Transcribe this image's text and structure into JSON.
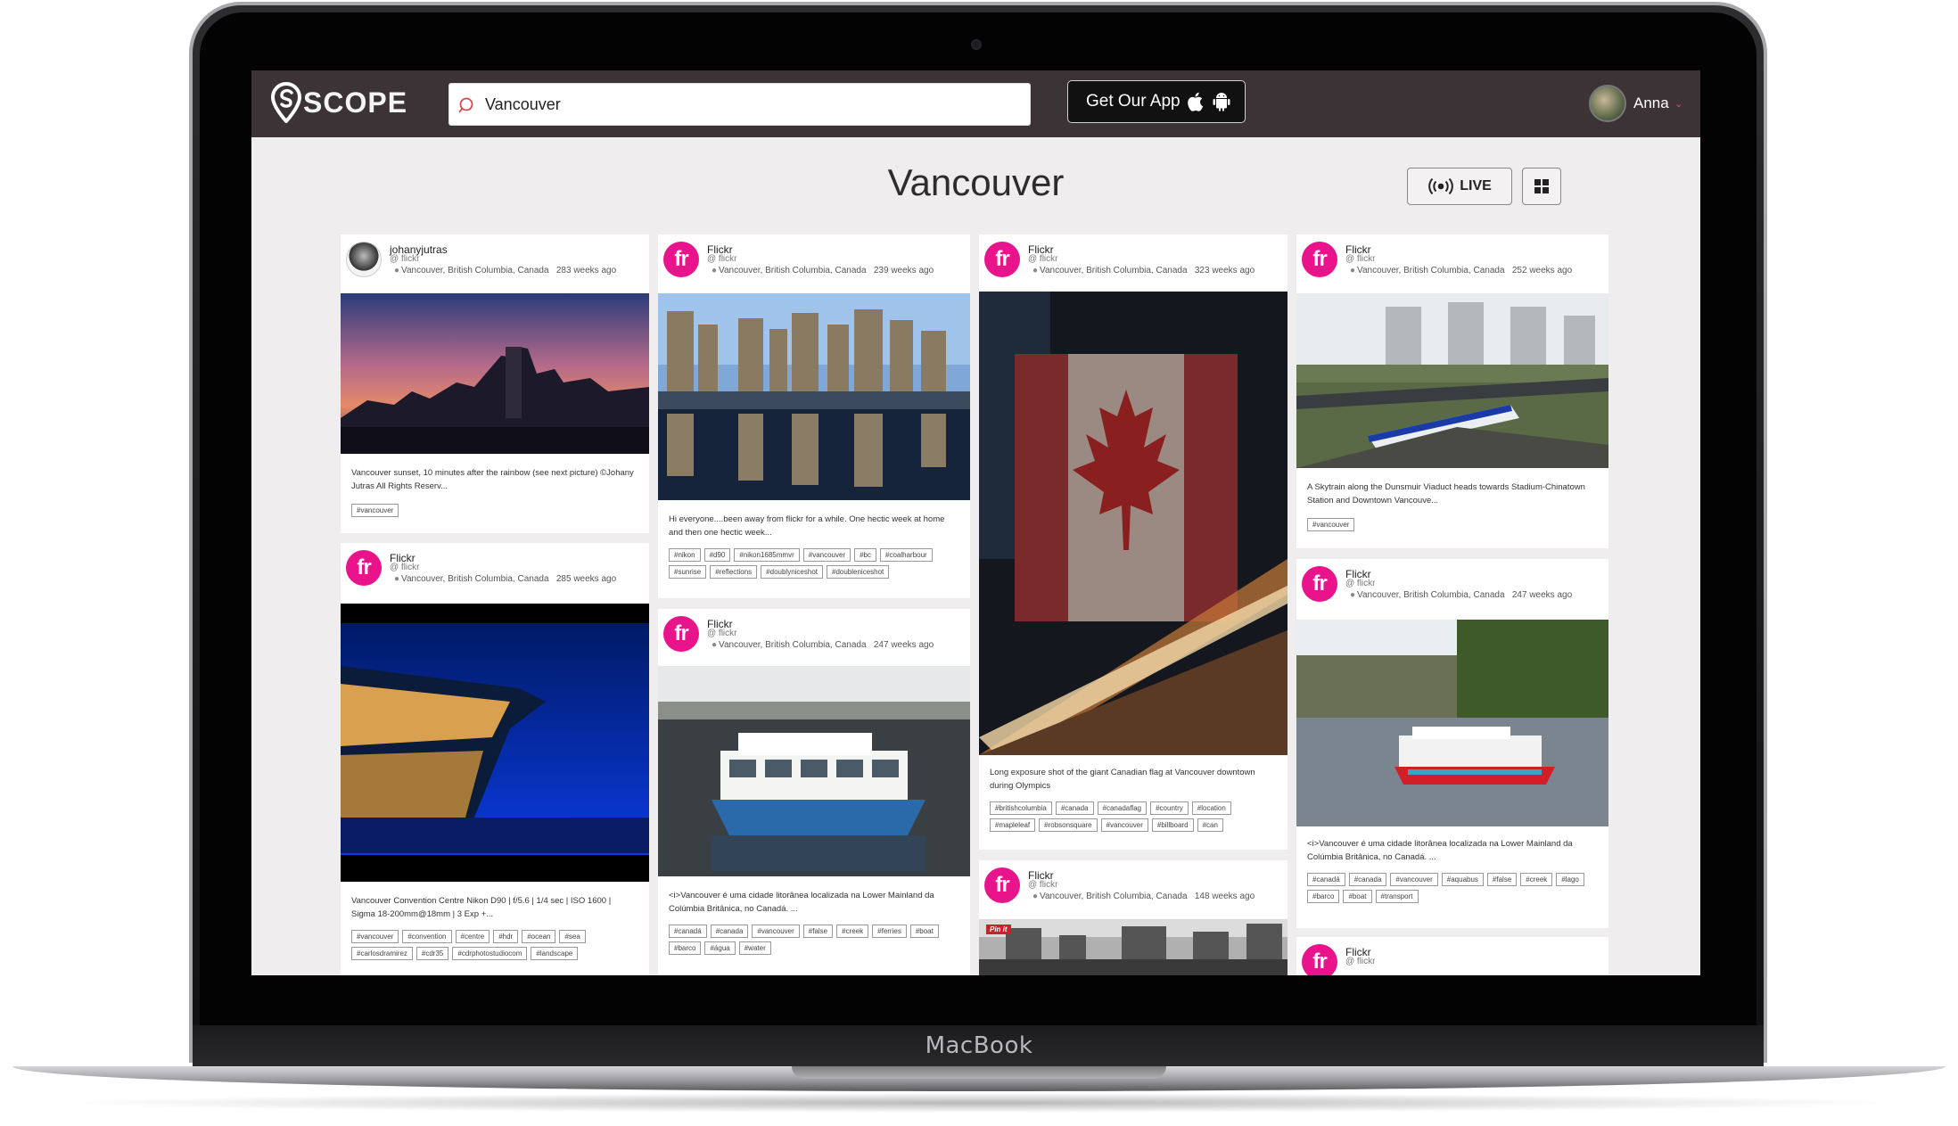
{
  "app": {
    "logo_text": "SCOPE",
    "brand_color": "#3c3336",
    "accent": "#e9138b"
  },
  "search": {
    "value": "Vancouver",
    "placeholder": ""
  },
  "get_app": {
    "label": "Get Our App"
  },
  "user": {
    "name": "Anna"
  },
  "page": {
    "title": "Vancouver",
    "live_label": "LIVE"
  },
  "device": {
    "label": "MacBook"
  },
  "cards": [
    {
      "user": "johanyjutras",
      "handle": "@ flickr",
      "location": "Vancouver, British Columbia, Canada",
      "time": "283 weeks ago",
      "caption": "Vancouver sunset, 10 minutes after the rainbow (see next picture) ©Johany Jutras All Rights Reserv...",
      "tags": [
        "#vancouver"
      ]
    },
    {
      "user": "Flickr",
      "handle": "@ flickr",
      "location": "Vancouver, British Columbia, Canada",
      "time": "285 weeks ago",
      "caption": "Vancouver Convention Centre Nikon D90 | f/5.6 | 1/4 sec | ISO 1600 | Sigma 18-200mm@18mm | 3 Exp +...",
      "tags": [
        "#vancouver",
        "#convention",
        "#centre",
        "#hdr",
        "#ocean",
        "#sea",
        "#carlosdramirez",
        "#cdr35",
        "#cdrphotostudiocom",
        "#landscape"
      ]
    },
    {
      "user": "Flickr",
      "handle": "@ flickr",
      "location": "Vancouver, British Columbia, Canada",
      "time": "239 weeks ago",
      "caption": "Hi everyone....been away from flickr for a while. One hectic week at home and then one hectic week...",
      "tags": [
        "#nikon",
        "#d90",
        "#nikon1685mmvr",
        "#vancouver",
        "#bc",
        "#coalharbour",
        "#sunrise",
        "#reflections",
        "#doublyniceshot",
        "#doubleniceshot"
      ]
    },
    {
      "user": "Flickr",
      "handle": "@ flickr",
      "location": "Vancouver, British Columbia, Canada",
      "time": "247 weeks ago",
      "caption": "<i>Vancouver é uma cidade litorânea localizada na Lower Mainland da Colúmbia Britânica, no Canadá. ...",
      "tags": [
        "#canadá",
        "#canada",
        "#vancouver",
        "#false",
        "#creek",
        "#ferries",
        "#boat",
        "#barco",
        "#água",
        "#water"
      ]
    },
    {
      "user": "Flickr",
      "handle": "@ flickr",
      "location": "Vancouver, British Columbia, Canada",
      "time": "323 weeks ago",
      "caption": "Long exposure shot of the giant Canadian flag at Vancouver downtown during Olympics",
      "tags": [
        "#britishcolumbia",
        "#canada",
        "#canadaflag",
        "#country",
        "#location",
        "#mapleleaf",
        "#robsonsquare",
        "#vancouver",
        "#billboard",
        "#can"
      ]
    },
    {
      "user": "Flickr",
      "handle": "@ flickr",
      "location": "Vancouver, British Columbia, Canada",
      "time": "148 weeks ago",
      "badge": "Pin it"
    },
    {
      "user": "Flickr",
      "handle": "@ flickr",
      "location": "Vancouver, British Columbia, Canada",
      "time": "252 weeks ago",
      "caption": "A Skytrain along the Dunsmuir Viaduct heads towards Stadium-Chinatown Station and Downtown Vancouve...",
      "tags": [
        "#vancouver"
      ]
    },
    {
      "user": "Flickr",
      "handle": "@ flickr",
      "location": "Vancouver, British Columbia, Canada",
      "time": "247 weeks ago",
      "caption": "<i>Vancouver é uma cidade litorânea localizada na Lower Mainland da Colúmbia Britânica, no Canadá. ...",
      "tags": [
        "#canadá",
        "#canada",
        "#vancouver",
        "#aquabus",
        "#false",
        "#creek",
        "#lago",
        "#barco",
        "#boat",
        "#transport"
      ]
    },
    {
      "user": "Flickr",
      "handle": "@ flickr"
    }
  ]
}
